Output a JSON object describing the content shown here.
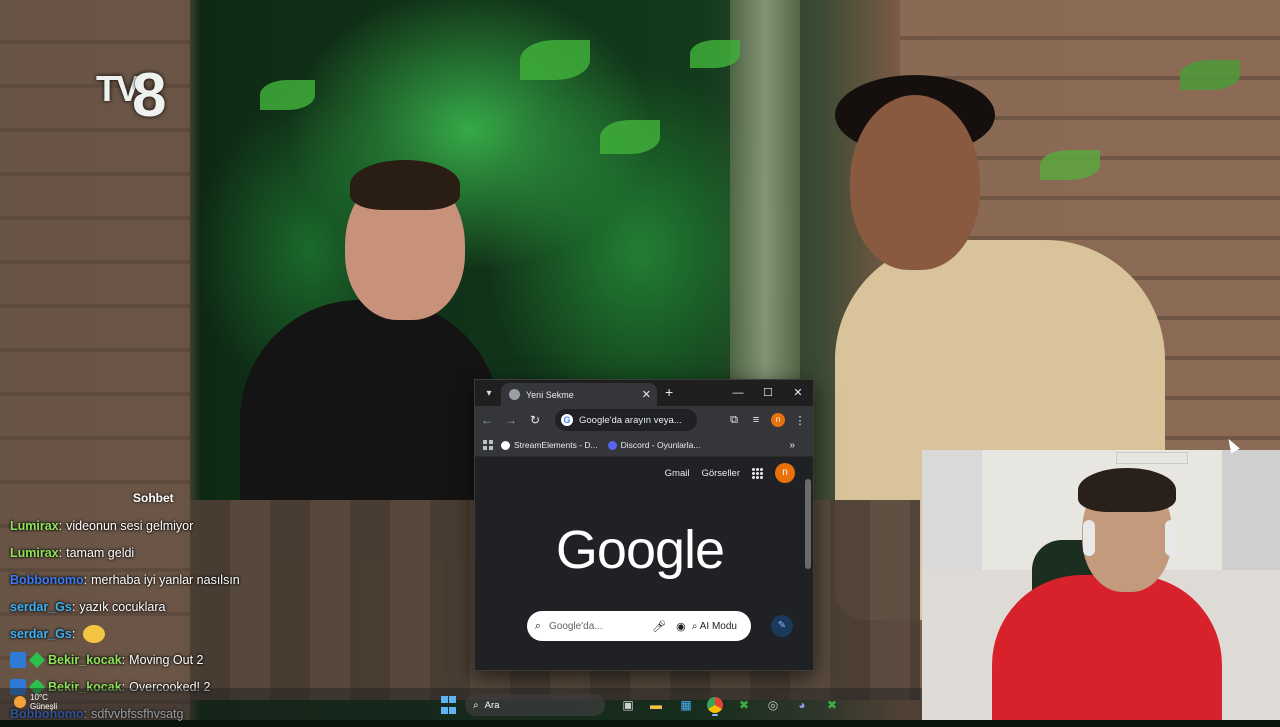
{
  "stream": {
    "channel_logo": {
      "prefix": "TV",
      "number": "8"
    }
  },
  "chat": {
    "title": "Sohbet",
    "messages": [
      {
        "user": "Lumirax",
        "user_color": "#8fe35a",
        "text": "videonun sesi gelmiyor",
        "badges": []
      },
      {
        "user": "Lumirax",
        "user_color": "#8fe35a",
        "text": "tamam geldi",
        "badges": []
      },
      {
        "user": "Bobbonomo",
        "user_color": "#3d7bf5",
        "text": "merhaba iyi yanlar nasılsın",
        "badges": []
      },
      {
        "user": "serdar_Gs",
        "user_color": "#3db3f5",
        "text": "yazık cocuklara",
        "badges": []
      },
      {
        "user": "serdar_Gs",
        "user_color": "#3db3f5",
        "text": "",
        "badges": [],
        "emote": true
      },
      {
        "user": "Bekir_kocak",
        "user_color": "#8fe35a",
        "text": "Moving Out 2",
        "badges": [
          "prime",
          "sub"
        ]
      },
      {
        "user": "Bekir_kocak",
        "user_color": "#8fe35a",
        "text": "Overcooked! 2",
        "badges": [
          "prime",
          "sub"
        ]
      },
      {
        "user": "Bobbonomo",
        "user_color": "#3d7bf5",
        "text": "sdfvvbfssfhvsatg",
        "badges": []
      }
    ]
  },
  "browser": {
    "tab_title": "Yeni Sekme",
    "omnibox_text": "Google'da arayın veya...",
    "profile_initial": "n",
    "bookmarks": [
      {
        "label": "StreamElements - D...",
        "icon_color": "#ffffff"
      },
      {
        "label": "Discord - Oyunlarla...",
        "icon_color": "#5865f2"
      }
    ],
    "header_links": {
      "gmail": "Gmail",
      "images": "Görseller"
    },
    "logo_text": "Google",
    "search_placeholder": "Google'da...",
    "ai_mode_label": "AI Modu"
  },
  "taskbar": {
    "weather_temp": "10°C",
    "weather_desc": "Güneşli",
    "search_label": "Ara",
    "apps": [
      "start",
      "search",
      "file-explorer",
      "task-view",
      "folder",
      "store",
      "chrome",
      "xbox",
      "steam",
      "discord",
      "xbox-game-bar"
    ]
  },
  "colors": {
    "browser_bg": "#202124",
    "accent_avatar": "#e8710a",
    "shirt_red": "#d8222b"
  }
}
